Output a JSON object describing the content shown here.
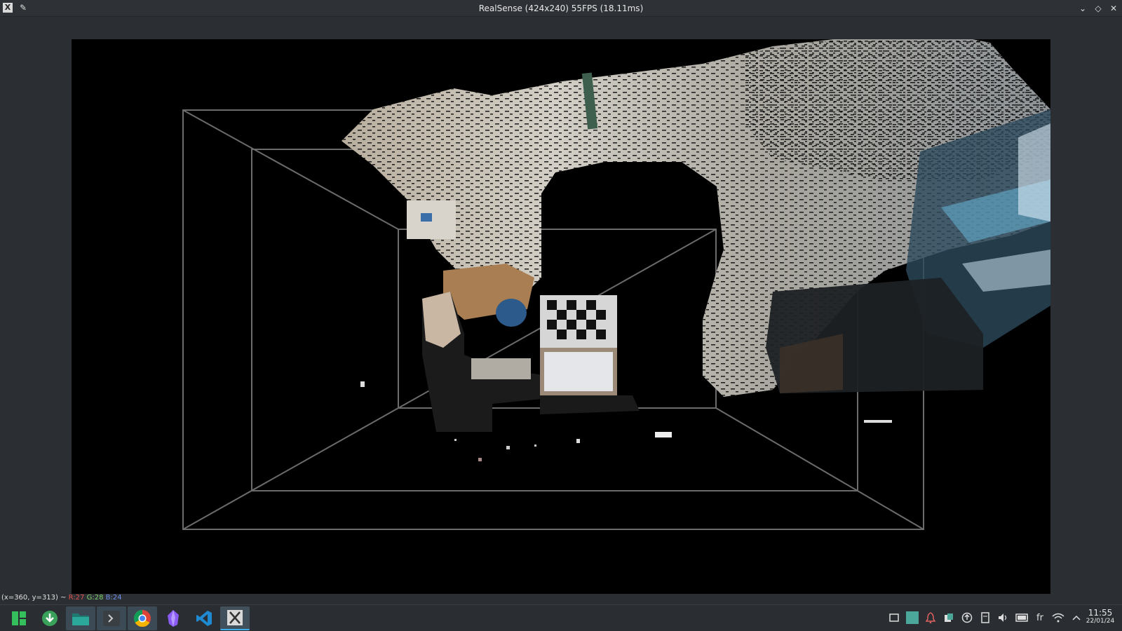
{
  "window": {
    "title": "RealSense (424x240) 55FPS (18.11ms)",
    "title_icon": "x-app-icon",
    "pin_icon": "pin-icon",
    "buttons": {
      "minimize": "⌄",
      "maximize": "◇",
      "close": "✕"
    }
  },
  "status": {
    "coords": "(x=360, y=313) ~ ",
    "r": "R:27",
    "g": "G:28",
    "b": "B:24"
  },
  "taskbar": {
    "apps": [
      {
        "name": "app-launcher",
        "icon": "manjaro-icon"
      },
      {
        "name": "update-manager",
        "icon": "download-circle-icon"
      },
      {
        "name": "file-manager",
        "icon": "folder-icon"
      },
      {
        "name": "terminal",
        "icon": "terminal-icon"
      },
      {
        "name": "chrome",
        "icon": "chrome-icon"
      },
      {
        "name": "obsidian",
        "icon": "obsidian-icon"
      },
      {
        "name": "vscode",
        "icon": "vscode-icon"
      },
      {
        "name": "x-app",
        "icon": "x-app-icon"
      }
    ],
    "tray": {
      "keyboard_layout": "fr"
    },
    "clock": {
      "time": "11:55",
      "date": "22/01/24"
    }
  },
  "colors": {
    "accent": "#3daee9",
    "frame_line": "#6b6b6b",
    "background": "#2b2f33"
  }
}
